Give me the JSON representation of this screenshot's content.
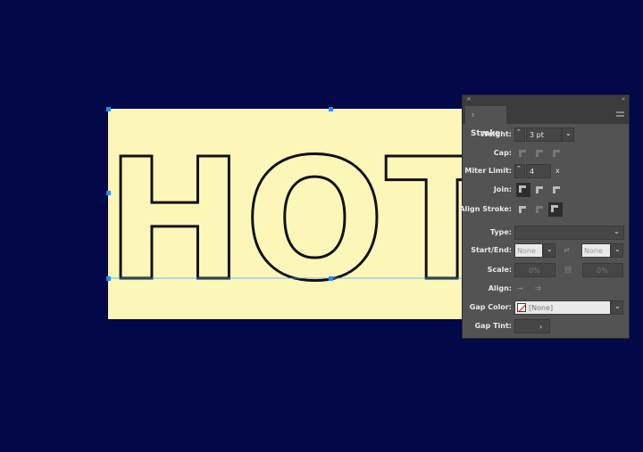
{
  "artwork": {
    "text": "HOT",
    "frame_color": "#fdf6b9",
    "background": "#020848",
    "selection_color": "#2b8cf0"
  },
  "panel": {
    "title": "Stroke",
    "close": "×",
    "collapse": "«",
    "weight": {
      "label": "Weight:",
      "value": "3 pt"
    },
    "cap": {
      "label": "Cap:"
    },
    "miter": {
      "label": "Miter Limit:",
      "value": "4",
      "suffix": "x"
    },
    "join": {
      "label": "Join:",
      "selected": "miter"
    },
    "align": {
      "label": "Align Stroke:",
      "selected": "outside"
    },
    "type": {
      "label": "Type:",
      "value": ""
    },
    "start_end": {
      "label": "Start/End:",
      "start": "None",
      "end": "None"
    },
    "scale": {
      "label": "Scale:",
      "start": "0%",
      "end": "0%"
    },
    "align_arrow": {
      "label": "Align:"
    },
    "gap_color": {
      "label": "Gap Color:",
      "value": "[None]"
    },
    "gap_tint": {
      "label": "Gap Tint:",
      "arrow": "›"
    }
  }
}
